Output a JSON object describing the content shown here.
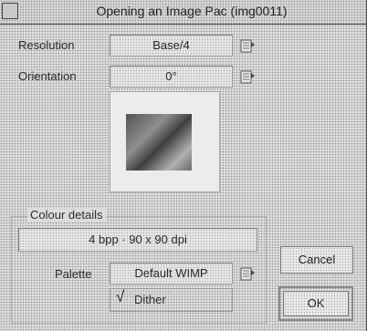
{
  "window": {
    "title": "Opening an Image Pac (img0011)"
  },
  "resolution": {
    "label": "Resolution",
    "value": "Base/4"
  },
  "orientation": {
    "label": "Orientation",
    "value": "0°"
  },
  "colour_details": {
    "group_label": "Colour details",
    "info": "4 bpp · 90 x 90 dpi",
    "palette_label": "Palette",
    "palette_value": "Default WIMP",
    "dither_label": "Dither",
    "dither_checked": true,
    "tick_glyph": "√"
  },
  "buttons": {
    "cancel": "Cancel",
    "ok": "OK"
  },
  "icons": {
    "close": "close-icon",
    "menu": "menu-icon"
  }
}
